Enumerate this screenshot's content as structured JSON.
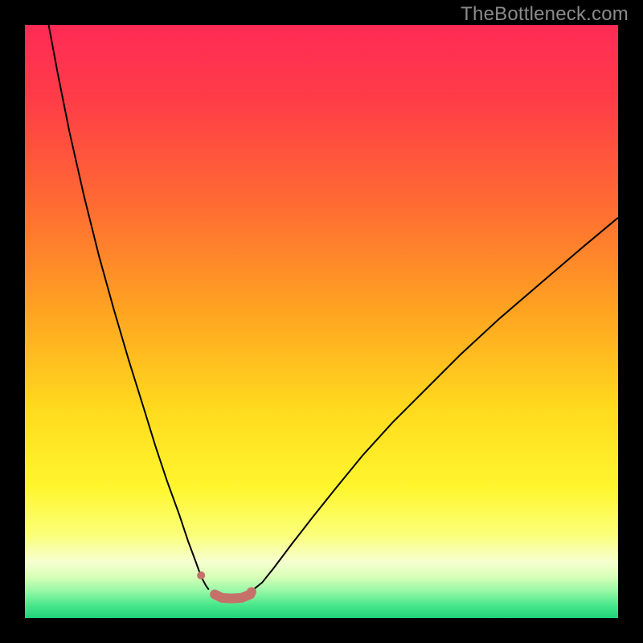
{
  "watermark": "TheBottleneck.com",
  "chart_data": {
    "type": "line",
    "title": "",
    "xlabel": "",
    "ylabel": "",
    "xlim": [
      0,
      100
    ],
    "ylim": [
      0,
      100
    ],
    "background_gradient": {
      "stops": [
        {
          "offset": 0,
          "color": "#ff2b55"
        },
        {
          "offset": 0.12,
          "color": "#ff3b48"
        },
        {
          "offset": 0.3,
          "color": "#ff6a33"
        },
        {
          "offset": 0.48,
          "color": "#ffa321"
        },
        {
          "offset": 0.65,
          "color": "#ffdb1e"
        },
        {
          "offset": 0.78,
          "color": "#fff62e"
        },
        {
          "offset": 0.86,
          "color": "#fbff7a"
        },
        {
          "offset": 0.905,
          "color": "#f6ffd0"
        },
        {
          "offset": 0.93,
          "color": "#d9ffb8"
        },
        {
          "offset": 0.955,
          "color": "#95f8a6"
        },
        {
          "offset": 0.978,
          "color": "#4ae78b"
        },
        {
          "offset": 1.0,
          "color": "#1fd27a"
        }
      ]
    },
    "series": [
      {
        "name": "left-curve",
        "color": "#000000",
        "width": 2,
        "x": [
          4.0,
          5.5,
          7.5,
          10.0,
          12.5,
          15.0,
          17.5,
          20.0,
          22.0,
          24.0,
          26.0,
          27.5,
          28.8,
          29.7,
          30.5,
          31.0
        ],
        "y": [
          100,
          92.0,
          82.0,
          71.0,
          61.0,
          52.0,
          43.5,
          35.5,
          29.0,
          23.0,
          17.5,
          13.0,
          9.5,
          7.0,
          5.5,
          4.8
        ]
      },
      {
        "name": "right-curve",
        "color": "#000000",
        "width": 2,
        "x": [
          38.5,
          40.0,
          42.0,
          45.0,
          48.5,
          52.5,
          57.0,
          62.0,
          67.5,
          73.5,
          80.0,
          87.0,
          94.0,
          100.0
        ],
        "y": [
          4.8,
          6.0,
          8.5,
          12.5,
          17.0,
          22.0,
          27.5,
          33.0,
          38.5,
          44.5,
          50.5,
          56.5,
          62.5,
          67.5
        ]
      },
      {
        "name": "valley-floor",
        "color": "#c5716a",
        "width": 12,
        "linecap": "round",
        "x": [
          32.0,
          33.2,
          34.8,
          36.5,
          38.0
        ],
        "y": [
          4.0,
          3.4,
          3.3,
          3.4,
          4.0
        ]
      }
    ],
    "markers": [
      {
        "name": "dot-left",
        "x": 29.7,
        "y": 7.2,
        "r": 5,
        "color": "#c5716a"
      },
      {
        "name": "dot-right",
        "x": 38.2,
        "y": 4.4,
        "r": 6,
        "color": "#c5716a"
      }
    ]
  }
}
